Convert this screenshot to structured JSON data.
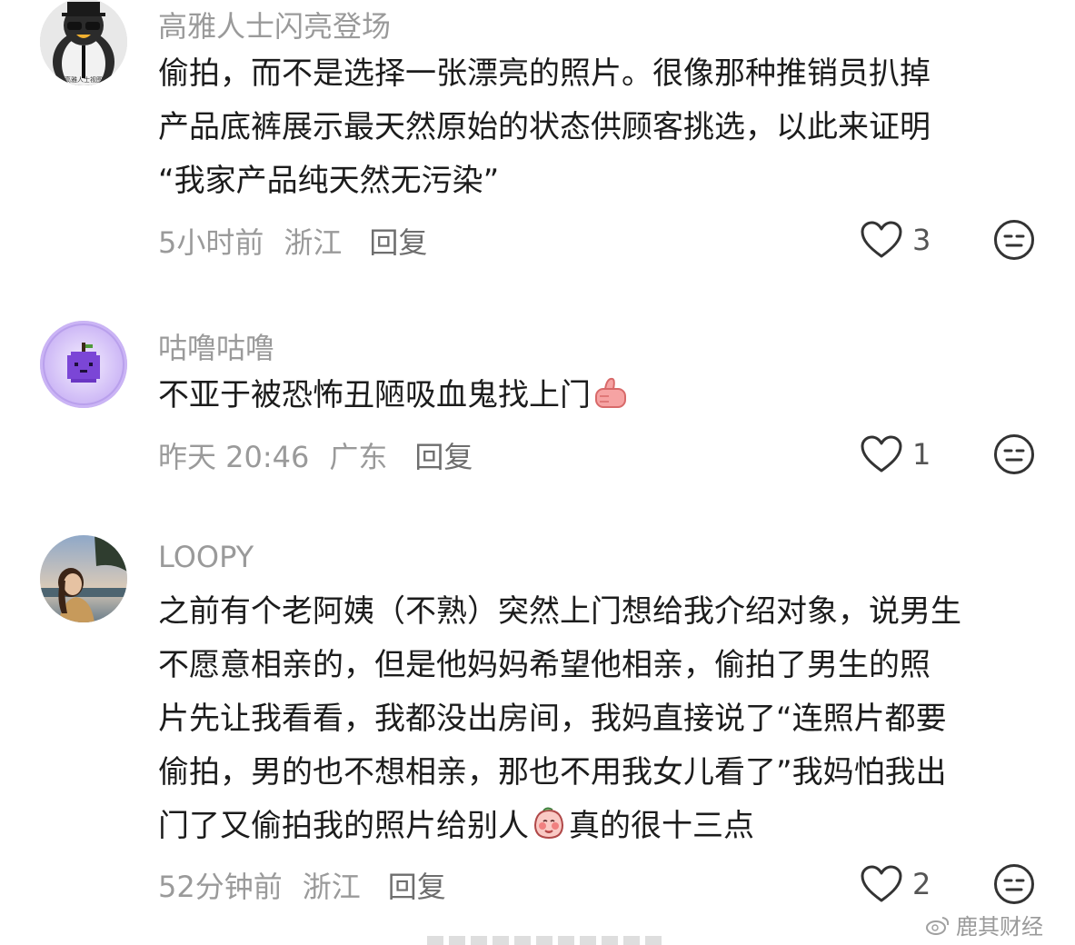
{
  "comments": [
    {
      "username": "高雅人士闪亮登场",
      "avatar_icon": "penguin-sunglasses-avatar",
      "avatar_caption": "高雅人士视图",
      "lines": [
        "偷拍，而不是选择一张漂亮的照片。很像那种推销员扒掉",
        "产品底裤展示最天然原始的状态供顾客挑选，以此来证明",
        "“我家产品纯天然无污染”"
      ],
      "time": "5小时前",
      "location": "浙江",
      "reply_label": "回复",
      "likes": "3"
    },
    {
      "username": "咕噜咕噜",
      "avatar_icon": "purple-pixel-fruit-avatar",
      "text": "不亚于被恐怖丑陋吸血鬼找上门",
      "emoji": "thumbs-up-emoji",
      "time": "昨天 20:46",
      "location": "广东",
      "reply_label": "回复",
      "likes": "1"
    },
    {
      "username": "LOOPY",
      "avatar_icon": "girl-photo-avatar",
      "lines": [
        "之前有个老阿姨（不熟）突然上门想给我介绍对象，说男生",
        "不愿意相亲的，但是他妈妈希望他相亲，偷拍了男生的照",
        "片先让我看看，我都没出房间，我妈直接说了“连照片都要",
        "偷拍，男的也不想相亲，那也不用我女儿看了”我妈怕我出"
      ],
      "last_line_before": "门了又偷拍我的照片给别人",
      "last_line_emoji": "blushing-peach-emoji",
      "last_line_after": "真的很十三点",
      "time": "52分钟前",
      "location": "浙江",
      "reply_label": "回复",
      "likes": "2"
    }
  ],
  "icons": {
    "like": "heart-outline-icon",
    "dislike": "meh-face-icon"
  },
  "watermark": "鹿其财经",
  "colors": {
    "meta_gray": "#9a9a9a",
    "text": "#1c1c1c",
    "background": "#ffffff"
  }
}
